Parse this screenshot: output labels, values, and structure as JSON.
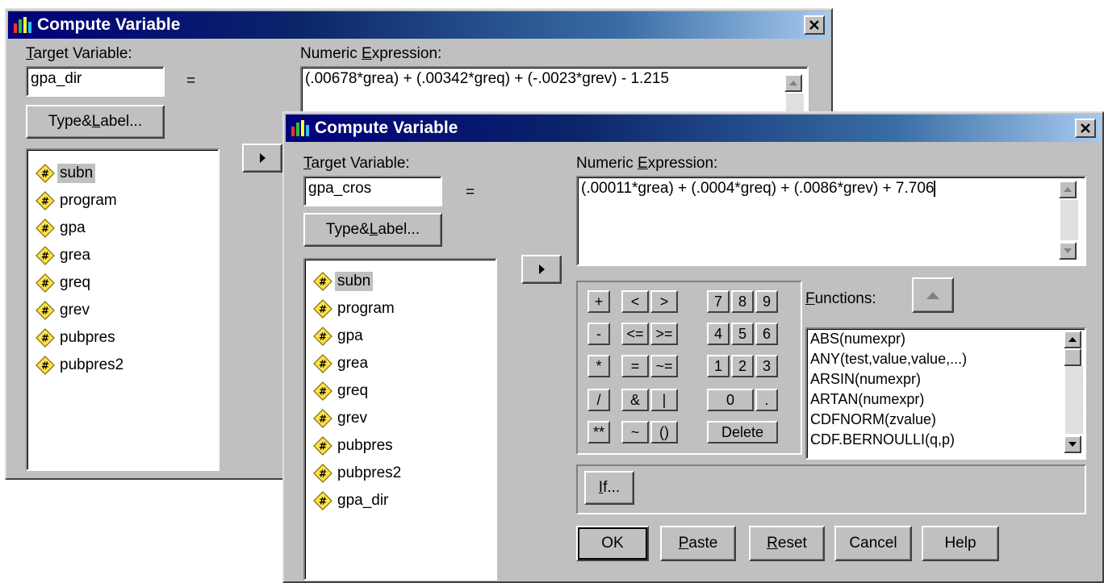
{
  "back_dialog": {
    "title": "Compute Variable",
    "target_label_pre": "",
    "target_label_mn": "T",
    "target_label_post": "arget Variable:",
    "target_value": "gpa_dir",
    "equals": "=",
    "expr_label_pre": "Numeric ",
    "expr_label_mn": "E",
    "expr_label_post": "xpression:",
    "expression": "(.00678*grea) + (.00342*greq) + (-.0023*grev) - 1.215",
    "type_label_pre": "Type&",
    "type_label_mn": "L",
    "type_label_post": "abel...",
    "variables": [
      "subn",
      "program",
      "gpa",
      "grea",
      "greq",
      "grev",
      "pubpres",
      "pubpres2"
    ]
  },
  "front_dialog": {
    "title": "Compute Variable",
    "target_label_pre": "",
    "target_label_mn": "T",
    "target_label_post": "arget Variable:",
    "target_value": "gpa_cros",
    "equals": "=",
    "expr_label_pre": "Numeric ",
    "expr_label_mn": "E",
    "expr_label_post": "xpression:",
    "expression": "(.00011*grea) + (.0004*greq) + (.0086*grev) + 7.706",
    "type_label_pre": "Type&",
    "type_label_mn": "L",
    "type_label_post": "abel...",
    "variables": [
      "subn",
      "program",
      "gpa",
      "grea",
      "greq",
      "grev",
      "pubpres",
      "pubpres2",
      "gpa_dir"
    ],
    "keypad": {
      "plus": "+",
      "lt": "<",
      "gt": ">",
      "minus": "-",
      "le": "<=",
      "ge": ">=",
      "mult": "*",
      "eq": "=",
      "ne": "~=",
      "div": "/",
      "and": "&",
      "or": "|",
      "pow": "**",
      "not": "~",
      "parens": "()",
      "d7": "7",
      "d8": "8",
      "d9": "9",
      "d4": "4",
      "d5": "5",
      "d6": "6",
      "d1": "1",
      "d2": "2",
      "d3": "3",
      "d0": "0",
      "dot": ".",
      "delete": "Delete"
    },
    "functions_label_mn": "F",
    "functions_label_post": "unctions:",
    "functions": [
      "ABS(numexpr)",
      "ANY(test,value,value,...)",
      "ARSIN(numexpr)",
      "ARTAN(numexpr)",
      "CDFNORM(zvalue)",
      "CDF.BERNOULLI(q,p)"
    ],
    "if_mn": "I",
    "if_post": "f...",
    "ok": "OK",
    "paste_mn": "P",
    "paste_post": "aste",
    "reset_mn": "R",
    "reset_post": "eset",
    "cancel": "Cancel",
    "help": "Help"
  }
}
